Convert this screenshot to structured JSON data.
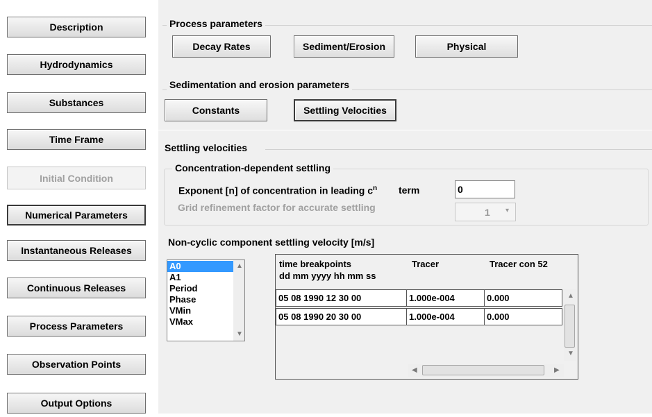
{
  "nav": {
    "description": "Description",
    "hydrodynamics": "Hydrodynamics",
    "substances": "Substances",
    "time_frame": "Time Frame",
    "initial_condition": "Initial Condition",
    "numerical_parameters": "Numerical Parameters",
    "instantaneous_releases": "Instantaneous Releases",
    "continuous_releases": "Continuous Releases",
    "process_parameters": "Process Parameters",
    "observation_points": "Observation Points",
    "output_options": "Output Options"
  },
  "process": {
    "title": "Process parameters",
    "decay_rates": "Decay Rates",
    "sediment_erosion": "Sediment/Erosion",
    "physical": "Physical"
  },
  "sedimentation": {
    "title": "Sedimentation and erosion parameters",
    "constants": "Constants",
    "settling_velocities": "Settling Velocities"
  },
  "settling": {
    "title": "Settling velocities",
    "conc_title": "Concentration-dependent settling",
    "exponent_label": "Exponent [n] of concentration in leading c",
    "exponent_sup": "n",
    "exponent_suffix": "term",
    "exponent_value": "0",
    "grid_label": "Grid refinement factor for accurate settling",
    "grid_value": "1"
  },
  "noncyclic": {
    "title": "Non-cyclic component settling velocity [m/s]",
    "list": [
      "A0",
      "A1",
      "Period",
      "Phase",
      "VMin",
      "VMax"
    ],
    "selected": "A0",
    "headers": {
      "col1_line1": "time breakpoints",
      "col1_line2": "dd mm yyyy hh mm ss",
      "col2": "Tracer",
      "col3": "Tracer con 52"
    },
    "rows": [
      [
        "05 08 1990 12 30 00",
        "1.000e-004",
        "0.000"
      ],
      [
        "05 08 1990 20 30 00",
        "1.000e-004",
        "0.000"
      ]
    ]
  }
}
